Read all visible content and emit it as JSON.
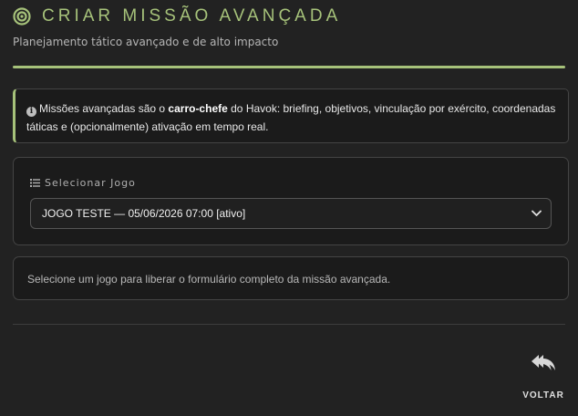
{
  "header": {
    "title": "CRIAR MISSÃO AVANÇADA",
    "subtitle": "Planejamento tático avançado e de alto impacto",
    "title_icon": "target-icon"
  },
  "info": {
    "icon": "info-circle-icon",
    "text_before": "Missões avançadas são o ",
    "text_bold": "carro-chefe",
    "text_after": " do Havok: briefing, objetivos, vinculação por exército, coordenadas táticas e (opcionalmente) ativação em tempo real."
  },
  "game_select": {
    "icon": "list-icon",
    "label": "Selecionar Jogo",
    "selected_value": "JOGO TESTE — 05/06/2026 07:00 [ativo]"
  },
  "notice": {
    "text": "Selecione um jogo para liberar o formulário completo da missão avançada."
  },
  "back": {
    "icon": "reply-icon",
    "label": "VOLTAR"
  },
  "colors": {
    "accent": "#a6c27a",
    "background": "#222222",
    "card": "#1b1b1b"
  }
}
